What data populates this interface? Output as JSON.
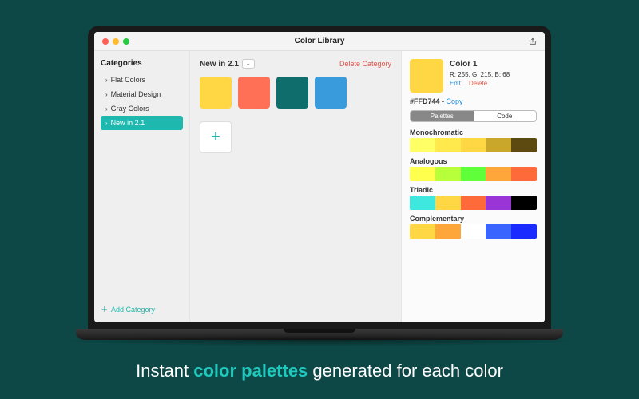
{
  "window_title": "Color Library",
  "sidebar": {
    "heading": "Categories",
    "items": [
      {
        "label": "Flat Colors",
        "selected": false
      },
      {
        "label": "Material Design",
        "selected": false
      },
      {
        "label": "Gray Colors",
        "selected": false
      },
      {
        "label": "New in 2.1",
        "selected": true
      }
    ],
    "add_label": "Add Category"
  },
  "main": {
    "category_name": "New in 2.1",
    "delete_label": "Delete Category",
    "swatches": [
      "#ffd744",
      "#ff7057",
      "#0f6e6b",
      "#3a9bdc"
    ]
  },
  "panel": {
    "color_name": "Color 1",
    "rgb_label": "R: 255, G: 215, B: 68",
    "edit_label": "Edit",
    "delete_label": "Delete",
    "hex": "#FFD744",
    "copy_label": "Copy",
    "tabs": {
      "palettes": "Palettes",
      "code": "Code",
      "active": "palettes"
    },
    "swatch": "#ffd744",
    "palettes": [
      {
        "name": "Monochromatic",
        "colors": [
          "#ffff66",
          "#ffe94d",
          "#ffd744",
          "#c9a72a",
          "#5c4a10"
        ]
      },
      {
        "name": "Analogous",
        "colors": [
          "#ffff4d",
          "#b7ff3a",
          "#5fff3a",
          "#ffa63a",
          "#ff6a3a"
        ]
      },
      {
        "name": "Triadic",
        "colors": [
          "#3fe8df",
          "#ffd744",
          "#ff6a3a",
          "#9b34d6",
          "#000000"
        ]
      },
      {
        "name": "Complementary",
        "colors": [
          "#ffd744",
          "#ffa63a",
          "#ffffff",
          "#3a66ff",
          "#1a2bff"
        ]
      }
    ]
  },
  "tagline": {
    "pre": "Instant ",
    "highlight": "color palettes",
    "post": " generated for each color"
  }
}
